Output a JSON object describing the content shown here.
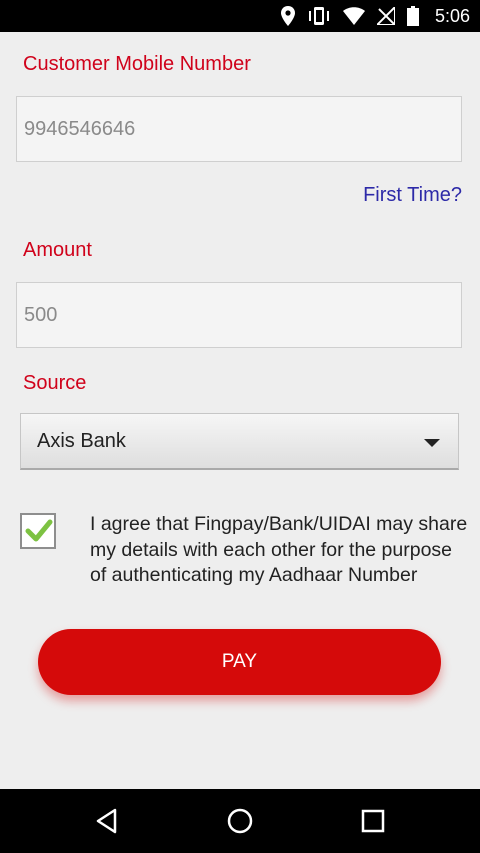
{
  "status_bar": {
    "time": "5:06",
    "icons": [
      "location-icon",
      "vibrate-icon",
      "wifi-icon",
      "no-signal-icon",
      "battery-icon"
    ]
  },
  "form": {
    "mobile_label": "Customer Mobile Number",
    "mobile_value": "9946546646",
    "first_time_link": "First Time?",
    "amount_label": "Amount",
    "amount_value": "500",
    "source_label": "Source",
    "source_selected": "Axis Bank",
    "consent_checked": true,
    "consent_text": "I agree that Fingpay/Bank/UIDAI may share my details with each other for the purpose of authenticating my Aadhaar Number",
    "pay_label": "PAY"
  },
  "nav_bar": {
    "buttons": [
      "back-icon",
      "home-icon",
      "recents-icon"
    ]
  },
  "colors": {
    "label_red": "#d0021b",
    "link_blue": "#2d2aa8",
    "button_red": "#d50a0a",
    "check_green": "#7dc242"
  }
}
